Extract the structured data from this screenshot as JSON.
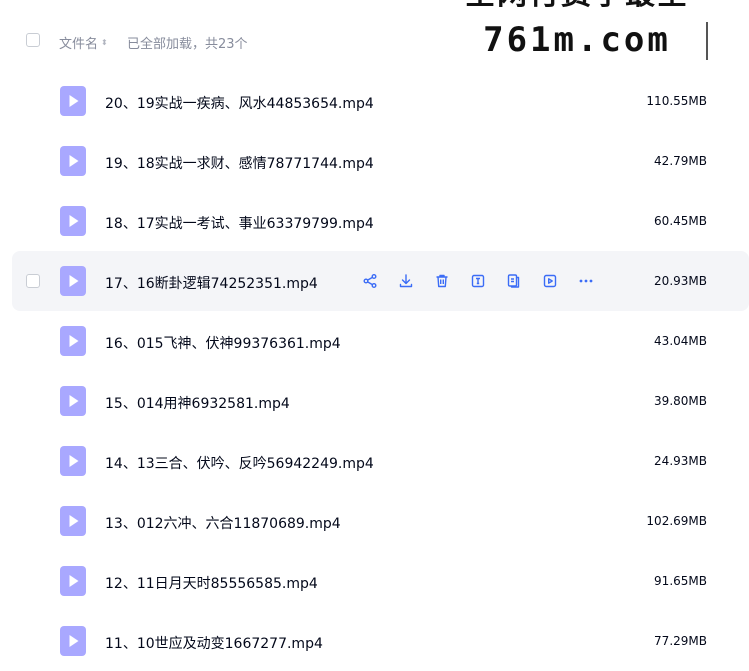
{
  "header": {
    "sort_label": "文件名",
    "sort_arrow": "⬍",
    "status_text": "已全部加载，共23个"
  },
  "watermark": {
    "line1": "全网付费学最全",
    "line2": "761m.com"
  },
  "row_actions": [
    "share-icon",
    "download-icon",
    "delete-icon",
    "rename-icon",
    "copy-icon",
    "open-icon",
    "more-icon"
  ],
  "files": [
    {
      "name": "20、19实战一疾病、风水44853654.mp4",
      "size": "110.55MB"
    },
    {
      "name": "19、18实战一求财、感情78771744.mp4",
      "size": "42.79MB"
    },
    {
      "name": "18、17实战一考试、事业63379799.mp4",
      "size": "60.45MB"
    },
    {
      "name": "17、16断卦逻辑74252351.mp4",
      "size": "20.93MB"
    },
    {
      "name": "16、015飞神、伏神99376361.mp4",
      "size": "43.04MB"
    },
    {
      "name": "15、014用神6932581.mp4",
      "size": "39.80MB"
    },
    {
      "name": "14、13三合、伏吟、反吟56942249.mp4",
      "size": "24.93MB"
    },
    {
      "name": "13、012六冲、六合11870689.mp4",
      "size": "102.69MB"
    },
    {
      "name": "12、11日月天时85556585.mp4",
      "size": "91.65MB"
    },
    {
      "name": "11、10世应及动变1667277.mp4",
      "size": "77.29MB"
    }
  ],
  "colors": {
    "icon": "#a9a8ff",
    "action": "#3b6cf6",
    "hover_bg": "#f4f5f8"
  }
}
